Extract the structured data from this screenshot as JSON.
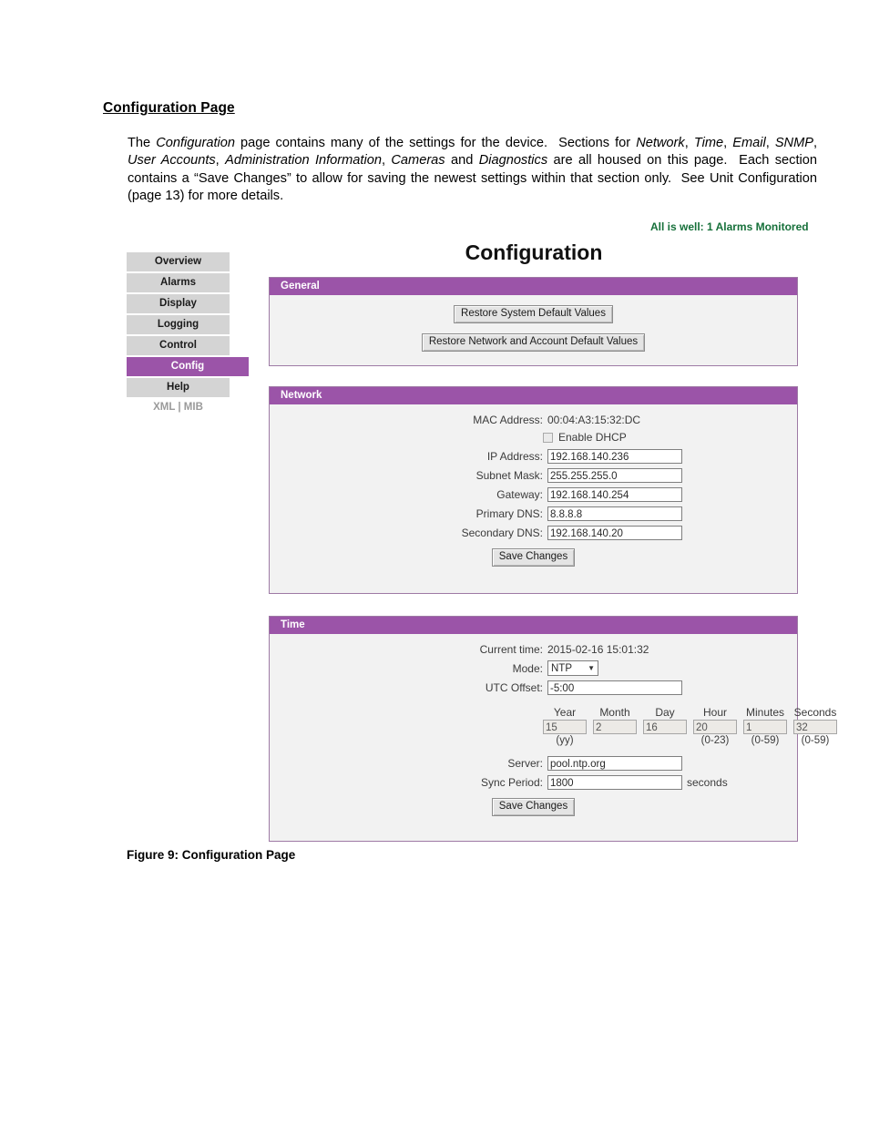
{
  "document": {
    "heading": "Configuration Page",
    "paragraph_html": "The <i>Configuration</i> page contains many of the settings for the device.&nbsp; Sections for <i>Network</i>, <i>Time</i>, <i>Email</i>, <i>SNMP</i>, <i>User Accounts</i>, <i>Administration Information</i>, <i>Cameras</i> and <i>Diagnostics</i> are all housed on this page.&nbsp; Each section contains a “Save Changes” to allow for saving the newest settings within that section only.&nbsp; See Unit Configuration (page 13) for more details.",
    "figure_caption": "Figure 9: Configuration Page"
  },
  "screenshot": {
    "status_text": "All is well: 1 Alarms Monitored",
    "page_title": "Configuration",
    "colors": {
      "accent_purple": "#9b54a8",
      "panel_border": "#9e7aa5",
      "panel_body": "#f2f2f2",
      "nav_inactive": "#d4d4d4",
      "status_green": "#16703a"
    },
    "sidebar": {
      "items": [
        {
          "label": "Overview",
          "active": false
        },
        {
          "label": "Alarms",
          "active": false
        },
        {
          "label": "Display",
          "active": false
        },
        {
          "label": "Logging",
          "active": false
        },
        {
          "label": "Control",
          "active": false
        },
        {
          "label": "Config",
          "active": true
        },
        {
          "label": "Help",
          "active": false
        }
      ],
      "links": {
        "xml": "XML",
        "separator": "|",
        "mib": "MIB"
      }
    },
    "panels": {
      "general": {
        "title": "General",
        "restore_system_button": "Restore System Default Values",
        "restore_network_button": "Restore Network and Account Default Values"
      },
      "network": {
        "title": "Network",
        "mac_label": "MAC Address:",
        "mac_value": "00:04:A3:15:32:DC",
        "dhcp_label": "Enable DHCP",
        "dhcp_checked": false,
        "fields": [
          {
            "label": "IP Address:",
            "value": "192.168.140.236"
          },
          {
            "label": "Subnet Mask:",
            "value": "255.255.255.0"
          },
          {
            "label": "Gateway:",
            "value": "192.168.140.254"
          },
          {
            "label": "Primary DNS:",
            "value": "8.8.8.8"
          },
          {
            "label": "Secondary DNS:",
            "value": "192.168.140.20"
          }
        ],
        "save_button": "Save Changes"
      },
      "time": {
        "title": "Time",
        "current_time_label": "Current time:",
        "current_time_value": "2015-02-16 15:01:32",
        "mode_label": "Mode:",
        "mode_value": "NTP",
        "utc_offset_label": "UTC Offset:",
        "utc_offset_value": "-5:00",
        "datetime_fields": [
          {
            "header": "Year",
            "value": "15",
            "note": "(yy)"
          },
          {
            "header": "Month",
            "value": "2",
            "note": ""
          },
          {
            "header": "Day",
            "value": "16",
            "note": ""
          },
          {
            "header": "Hour",
            "value": "20",
            "note": "(0-23)"
          },
          {
            "header": "Minutes",
            "value": "1",
            "note": "(0-59)"
          },
          {
            "header": "Seconds",
            "value": "32",
            "note": "(0-59)"
          }
        ],
        "server_label": "Server:",
        "server_value": "pool.ntp.org",
        "sync_period_label": "Sync Period:",
        "sync_period_value": "1800",
        "sync_period_suffix": "seconds",
        "save_button": "Save Changes"
      }
    }
  }
}
